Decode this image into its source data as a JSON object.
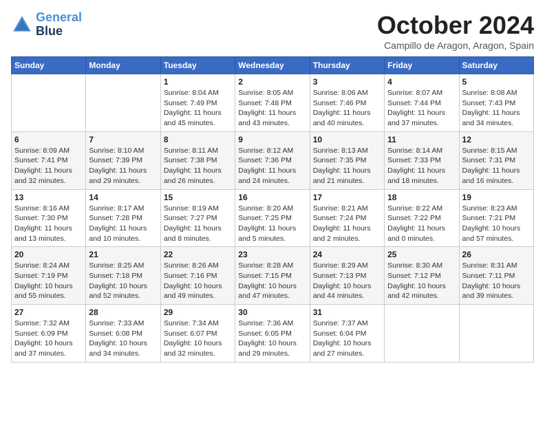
{
  "header": {
    "logo_line1": "General",
    "logo_line2": "Blue",
    "month": "October 2024",
    "location": "Campillo de Aragon, Aragon, Spain"
  },
  "days_of_week": [
    "Sunday",
    "Monday",
    "Tuesday",
    "Wednesday",
    "Thursday",
    "Friday",
    "Saturday"
  ],
  "weeks": [
    [
      {
        "day": "",
        "info": ""
      },
      {
        "day": "",
        "info": ""
      },
      {
        "day": "1",
        "info": "Sunrise: 8:04 AM\nSunset: 7:49 PM\nDaylight: 11 hours\nand 45 minutes."
      },
      {
        "day": "2",
        "info": "Sunrise: 8:05 AM\nSunset: 7:48 PM\nDaylight: 11 hours\nand 43 minutes."
      },
      {
        "day": "3",
        "info": "Sunrise: 8:06 AM\nSunset: 7:46 PM\nDaylight: 11 hours\nand 40 minutes."
      },
      {
        "day": "4",
        "info": "Sunrise: 8:07 AM\nSunset: 7:44 PM\nDaylight: 11 hours\nand 37 minutes."
      },
      {
        "day": "5",
        "info": "Sunrise: 8:08 AM\nSunset: 7:43 PM\nDaylight: 11 hours\nand 34 minutes."
      }
    ],
    [
      {
        "day": "6",
        "info": "Sunrise: 8:09 AM\nSunset: 7:41 PM\nDaylight: 11 hours\nand 32 minutes."
      },
      {
        "day": "7",
        "info": "Sunrise: 8:10 AM\nSunset: 7:39 PM\nDaylight: 11 hours\nand 29 minutes."
      },
      {
        "day": "8",
        "info": "Sunrise: 8:11 AM\nSunset: 7:38 PM\nDaylight: 11 hours\nand 26 minutes."
      },
      {
        "day": "9",
        "info": "Sunrise: 8:12 AM\nSunset: 7:36 PM\nDaylight: 11 hours\nand 24 minutes."
      },
      {
        "day": "10",
        "info": "Sunrise: 8:13 AM\nSunset: 7:35 PM\nDaylight: 11 hours\nand 21 minutes."
      },
      {
        "day": "11",
        "info": "Sunrise: 8:14 AM\nSunset: 7:33 PM\nDaylight: 11 hours\nand 18 minutes."
      },
      {
        "day": "12",
        "info": "Sunrise: 8:15 AM\nSunset: 7:31 PM\nDaylight: 11 hours\nand 16 minutes."
      }
    ],
    [
      {
        "day": "13",
        "info": "Sunrise: 8:16 AM\nSunset: 7:30 PM\nDaylight: 11 hours\nand 13 minutes."
      },
      {
        "day": "14",
        "info": "Sunrise: 8:17 AM\nSunset: 7:28 PM\nDaylight: 11 hours\nand 10 minutes."
      },
      {
        "day": "15",
        "info": "Sunrise: 8:19 AM\nSunset: 7:27 PM\nDaylight: 11 hours\nand 8 minutes."
      },
      {
        "day": "16",
        "info": "Sunrise: 8:20 AM\nSunset: 7:25 PM\nDaylight: 11 hours\nand 5 minutes."
      },
      {
        "day": "17",
        "info": "Sunrise: 8:21 AM\nSunset: 7:24 PM\nDaylight: 11 hours\nand 2 minutes."
      },
      {
        "day": "18",
        "info": "Sunrise: 8:22 AM\nSunset: 7:22 PM\nDaylight: 11 hours\nand 0 minutes."
      },
      {
        "day": "19",
        "info": "Sunrise: 8:23 AM\nSunset: 7:21 PM\nDaylight: 10 hours\nand 57 minutes."
      }
    ],
    [
      {
        "day": "20",
        "info": "Sunrise: 8:24 AM\nSunset: 7:19 PM\nDaylight: 10 hours\nand 55 minutes."
      },
      {
        "day": "21",
        "info": "Sunrise: 8:25 AM\nSunset: 7:18 PM\nDaylight: 10 hours\nand 52 minutes."
      },
      {
        "day": "22",
        "info": "Sunrise: 8:26 AM\nSunset: 7:16 PM\nDaylight: 10 hours\nand 49 minutes."
      },
      {
        "day": "23",
        "info": "Sunrise: 8:28 AM\nSunset: 7:15 PM\nDaylight: 10 hours\nand 47 minutes."
      },
      {
        "day": "24",
        "info": "Sunrise: 8:29 AM\nSunset: 7:13 PM\nDaylight: 10 hours\nand 44 minutes."
      },
      {
        "day": "25",
        "info": "Sunrise: 8:30 AM\nSunset: 7:12 PM\nDaylight: 10 hours\nand 42 minutes."
      },
      {
        "day": "26",
        "info": "Sunrise: 8:31 AM\nSunset: 7:11 PM\nDaylight: 10 hours\nand 39 minutes."
      }
    ],
    [
      {
        "day": "27",
        "info": "Sunrise: 7:32 AM\nSunset: 6:09 PM\nDaylight: 10 hours\nand 37 minutes."
      },
      {
        "day": "28",
        "info": "Sunrise: 7:33 AM\nSunset: 6:08 PM\nDaylight: 10 hours\nand 34 minutes."
      },
      {
        "day": "29",
        "info": "Sunrise: 7:34 AM\nSunset: 6:07 PM\nDaylight: 10 hours\nand 32 minutes."
      },
      {
        "day": "30",
        "info": "Sunrise: 7:36 AM\nSunset: 6:05 PM\nDaylight: 10 hours\nand 29 minutes."
      },
      {
        "day": "31",
        "info": "Sunrise: 7:37 AM\nSunset: 6:04 PM\nDaylight: 10 hours\nand 27 minutes."
      },
      {
        "day": "",
        "info": ""
      },
      {
        "day": "",
        "info": ""
      }
    ]
  ]
}
